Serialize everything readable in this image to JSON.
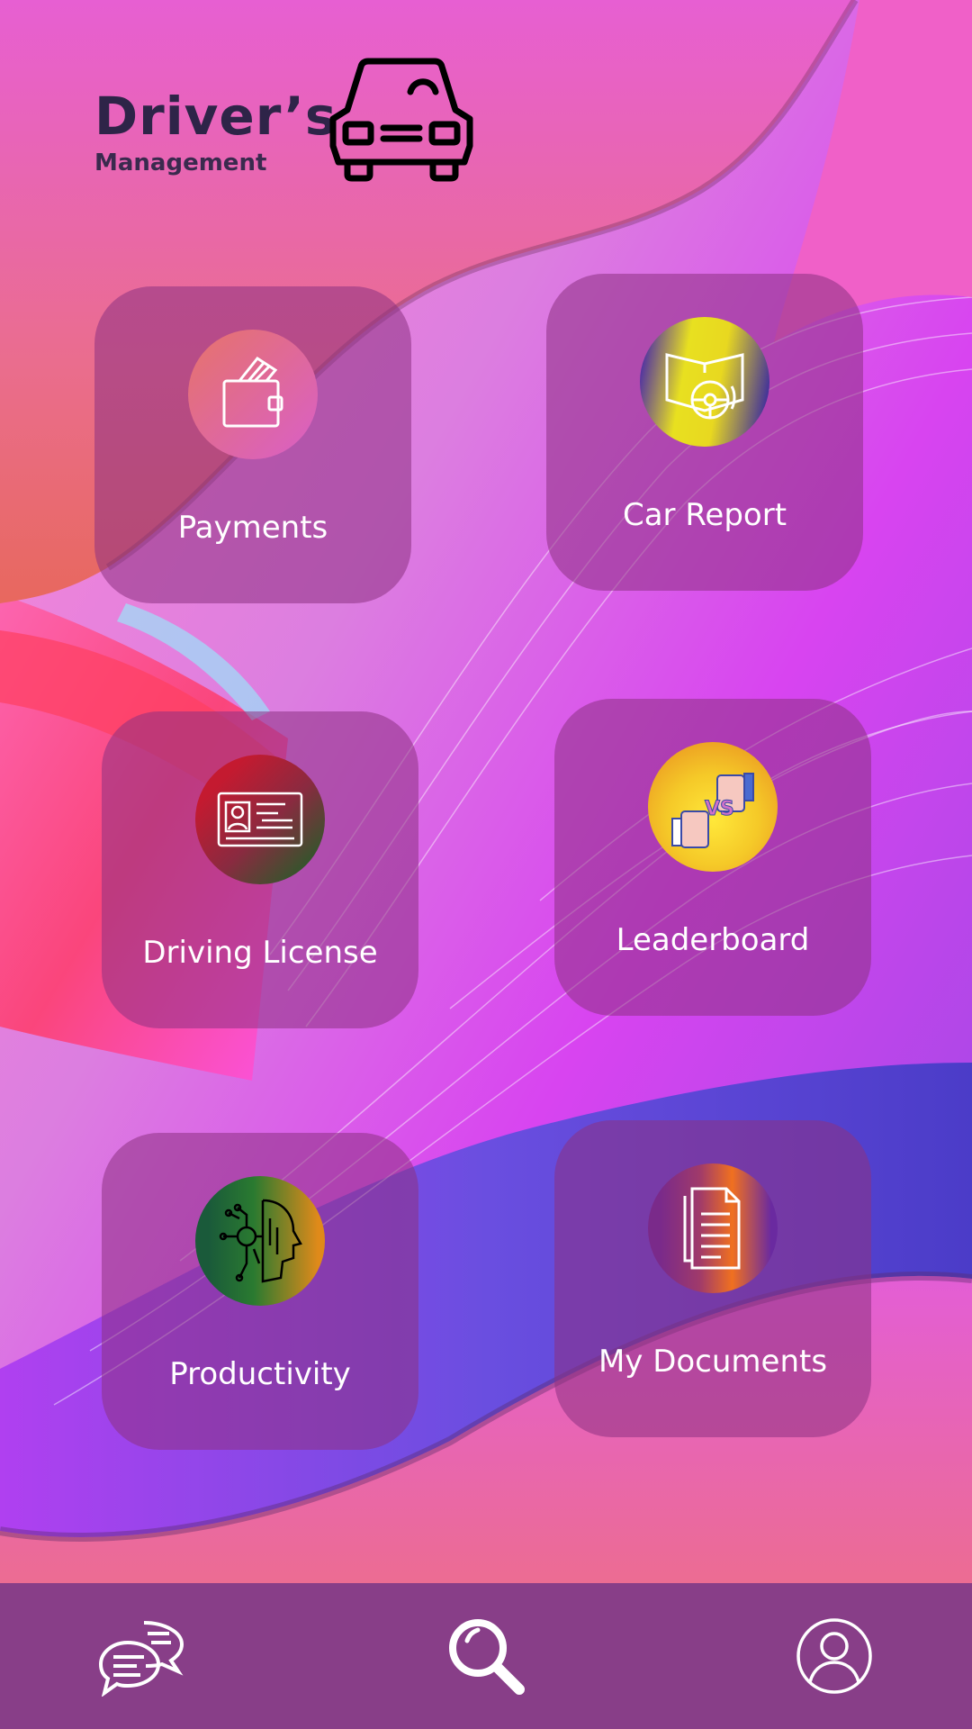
{
  "app": {
    "title": "Driver’s",
    "subtitle": "Management",
    "logo_icon": "car-front-icon"
  },
  "tiles": [
    {
      "label": "Payments",
      "icon": "wallet-icon"
    },
    {
      "label": "Car Report",
      "icon": "steering-wheel-book-icon"
    },
    {
      "label": "Driving License",
      "icon": "id-card-icon"
    },
    {
      "label": "Leaderboard",
      "icon": "versus-hands-icon"
    },
    {
      "label": "Productivity",
      "icon": "ai-head-circuit-icon"
    },
    {
      "label": "My Documents",
      "icon": "documents-icon"
    }
  ],
  "bottom_nav": [
    {
      "icon": "chat-bubbles-icon"
    },
    {
      "icon": "search-icon"
    },
    {
      "icon": "user-profile-icon"
    }
  ],
  "colors": {
    "nav_bg": "#883e88",
    "tile_bg": "rgba(140,50,130,0.55)",
    "title_color": "#2e2448",
    "text_white": "#ffffff"
  }
}
